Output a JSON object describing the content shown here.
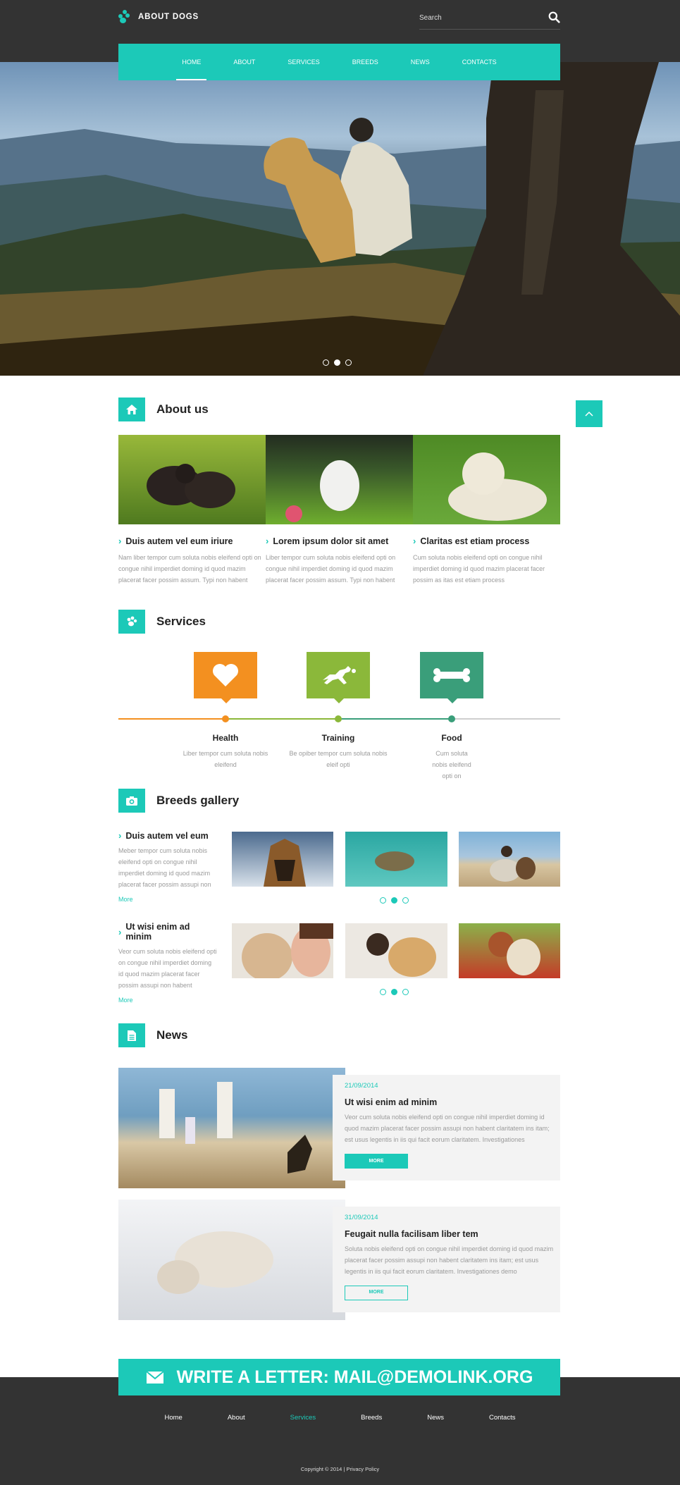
{
  "header": {
    "brand": "ABOUT DOGS",
    "search_placeholder": "Search"
  },
  "nav": [
    {
      "label": "HOME",
      "active": true
    },
    {
      "label": "ABOUT",
      "active": false
    },
    {
      "label": "SERVICES",
      "active": false
    },
    {
      "label": "BREEDS",
      "active": false
    },
    {
      "label": "NEWS",
      "active": false
    },
    {
      "label": "CONTACTS",
      "active": false
    }
  ],
  "hero": {
    "slide_count": 3,
    "active_slide": 2
  },
  "about": {
    "title": "About us",
    "cards": [
      {
        "title": "Duis autem vel eum iriure",
        "text": "Nam liber tempor cum soluta nobis eleifend opti on congue nihil imperdiet doming id quod mazim placerat facer possim assum. Typi non habent"
      },
      {
        "title": "Lorem ipsum dolor sit amet",
        "text": "Liber tempor cum soluta nobis eleifend opti on congue nihil imperdiet doming id quod mazim placerat facer possim assum. Typi non habent"
      },
      {
        "title": "Claritas est etiam process",
        "text": "Cum soluta nobis eleifend opti on congue nihil imperdiet doming id quod mazim placerat facer possim as itas est etiam process"
      }
    ]
  },
  "services": {
    "title": "Services",
    "items": [
      {
        "name": "Health",
        "text": "Liber tempor cum soluta nobis eleifend",
        "color": "#f39020",
        "icon": "heart-icon"
      },
      {
        "name": "Training",
        "text": "Be opiber tempor cum soluta nobis eleif opti",
        "color": "#8bb83a",
        "icon": "jumping-dog-icon"
      },
      {
        "name": "Food",
        "text": "Cum soluta nobis eleifend opti on",
        "color": "#3a9e7a",
        "icon": "bone-icon"
      }
    ]
  },
  "gallery": {
    "title": "Breeds gallery",
    "rows": [
      {
        "title": "Duis autem vel eum",
        "text": "Meber tempor cum soluta nobis eleifend opti on congue nihil imperdiet doming id quod mazim placerat facer possim assupi non",
        "more": "More"
      },
      {
        "title": "Ut wisi enim ad minim",
        "text": "Veor cum soluta nobis eleifend opti on congue nihil imperdiet doming id quod mazim placerat facer possim assupi non habent",
        "more": "More"
      }
    ]
  },
  "news": {
    "title": "News",
    "items": [
      {
        "date": "21/09/2014",
        "title": "Ut wisi enim ad minim",
        "text": "Veor cum soluta nobis eleifend opti on congue nihil imperdiet doming id quod mazim placerat facer possim assupi non habent claritatem ins itam; est usus legentis in iis qui facit eorum claritatem. Investigationes",
        "button": "MORE"
      },
      {
        "date": "31/09/2014",
        "title": "Feugait nulla facilisam liber tem",
        "text": "Soluta nobis eleifend opti on congue nihil imperdiet doming id quod mazim placerat facer possim assupi non habent claritatem ins itam; est usus legentis in iis qui facit eorum claritatem. Investigationes demo",
        "button": "MORE"
      }
    ]
  },
  "footer": {
    "banner": "WRITE A LETTER: MAIL@DEMOLINK.ORG",
    "links": [
      {
        "label": "Home",
        "active": false
      },
      {
        "label": "About",
        "active": false
      },
      {
        "label": "Services",
        "active": true
      },
      {
        "label": "Breeds",
        "active": false
      },
      {
        "label": "News",
        "active": false
      },
      {
        "label": "Contacts",
        "active": false
      }
    ],
    "copyright": "Copyright © 2014 | Privacy Policy"
  },
  "colors": {
    "accent": "#1cc9b8",
    "dark": "#333333"
  }
}
